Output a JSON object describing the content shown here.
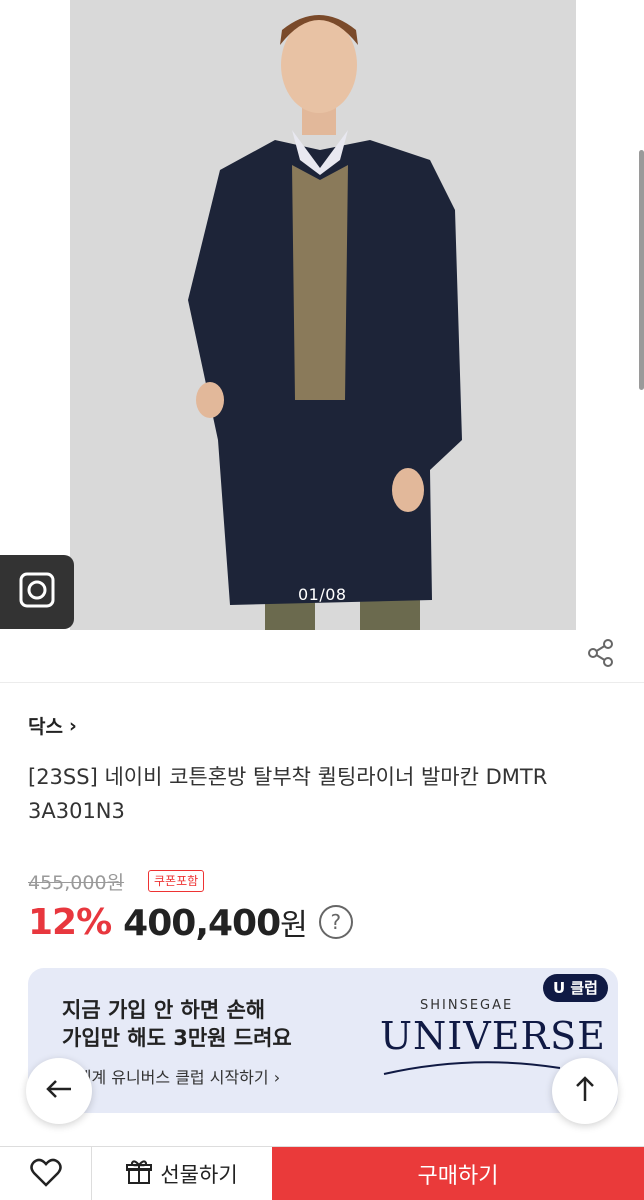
{
  "gallery": {
    "counter": "01/08",
    "image_alt": "model wearing navy coat"
  },
  "product": {
    "brand": "닥스",
    "brand_arrow": "›",
    "title": "[23SS] 네이비 코튼혼방 탈부착 퀼팅라이너 발마칸 DMTR 3A301N3",
    "original_price": "455,000원",
    "coupon_badge": "쿠폰포함",
    "discount": "12%",
    "sale_price": "400,400",
    "currency": "원",
    "help": "?"
  },
  "banner": {
    "line1": "지금 가입 안 하면 손해",
    "line2": "가입만 해도 3만원 드려요",
    "link": "신세계 유니버스 클럽 시작하기 ›",
    "badge": "U 클럽",
    "brand_small": "SHINSEGAE",
    "brand_big": "UNIVERSE"
  },
  "bottom_bar": {
    "gift_label": "선물하기",
    "buy_label": "구매하기"
  },
  "colors": {
    "accent": "#ea3a3a",
    "discount": "#e8373e",
    "banner_bg": "#e6eaf7",
    "brand_navy": "#101a44"
  },
  "icons": [
    "camera-icon",
    "share-icon",
    "help-icon",
    "arrow-left-icon",
    "arrow-up-icon",
    "heart-icon",
    "gift-icon"
  ]
}
